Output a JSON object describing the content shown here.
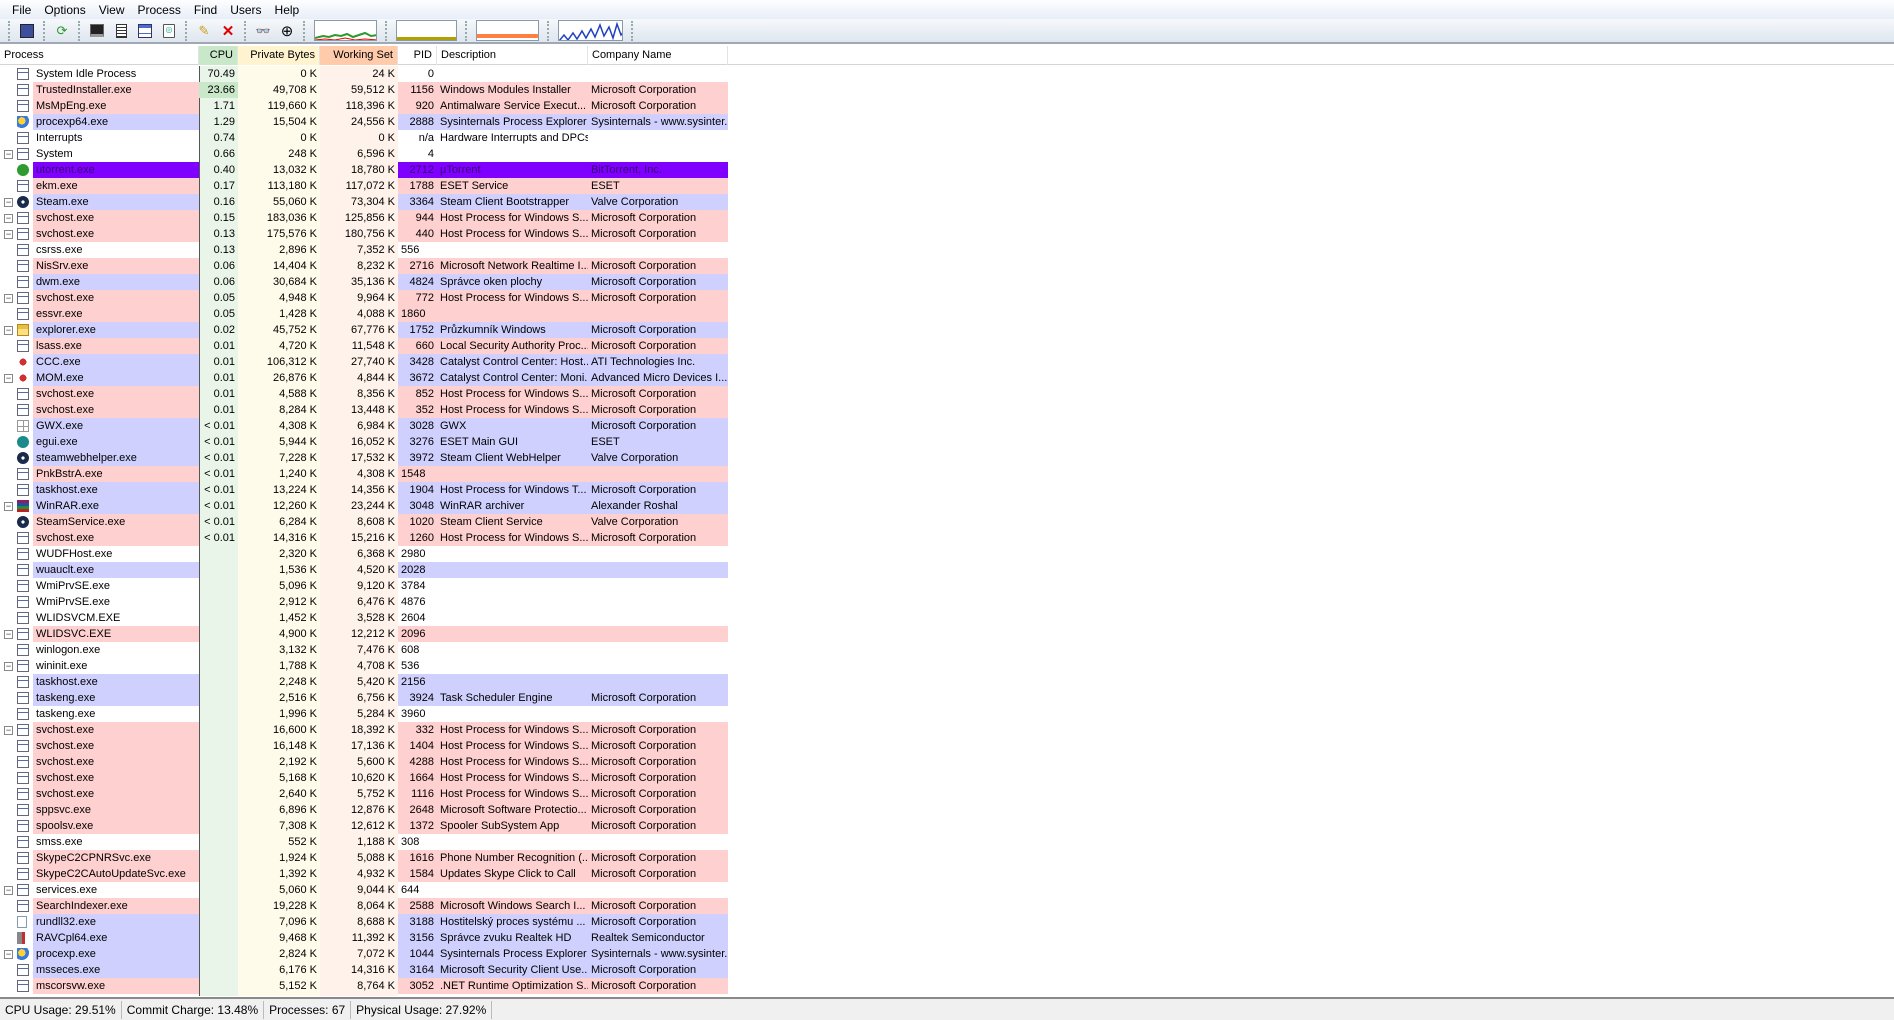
{
  "menu": [
    "File",
    "Options",
    "View",
    "Process",
    "Find",
    "Users",
    "Help"
  ],
  "columns": {
    "process": "Process",
    "cpu": "CPU",
    "private_bytes": "Private Bytes",
    "working_set": "Working Set",
    "pid": "PID",
    "description": "Description",
    "company": "Company Name"
  },
  "colors": {
    "pink": "#ffd0d0",
    "blue": "#d0d0ff",
    "purple": "#8000ff",
    "white": "#ffffff",
    "cpu_col": "#eaf5ea",
    "pb_col": "#fffbea",
    "ws_col": "#fff2ea"
  },
  "status": {
    "cpu": "CPU Usage: 29.51%",
    "commit": "Commit Charge: 13.48%",
    "processes": "Processes: 67",
    "physical": "Physical Usage: 27.92%"
  },
  "rows": [
    [
      "System Idle Process",
      "70.49",
      "0 K",
      "24 K",
      "0",
      "",
      "",
      "white",
      0,
      "win"
    ],
    [
      "TrustedInstaller.exe",
      "23.66",
      "49,708 K",
      "59,512 K",
      "1156",
      "Windows Modules Installer",
      "Microsoft Corporation",
      "pink",
      0,
      "win"
    ],
    [
      "MsMpEng.exe",
      "1.71",
      "119,660 K",
      "118,396 K",
      "920",
      "Antimalware Service Execut...",
      "Microsoft Corporation",
      "pink",
      0,
      "win"
    ],
    [
      "procexp64.exe",
      "1.29",
      "15,504 K",
      "24,556 K",
      "2888",
      "Sysinternals Process Explorer",
      "Sysinternals - www.sysinter...",
      "blue",
      0,
      "procexp"
    ],
    [
      "Interrupts",
      "0.74",
      "0 K",
      "0 K",
      "n/a",
      "Hardware Interrupts and DPCs",
      "",
      "white",
      0,
      "win"
    ],
    [
      "System",
      "0.66",
      "248 K",
      "6,596 K",
      "4",
      "",
      "",
      "white",
      1,
      "win"
    ],
    [
      "utorrent.exe",
      "0.40",
      "13,032 K",
      "18,780 K",
      "2712",
      "µTorrent",
      "BitTorrent, Inc.",
      "purple",
      0,
      "utorrent"
    ],
    [
      "ekm.exe",
      "0.17",
      "113,180 K",
      "117,072 K",
      "1788",
      "ESET Service",
      "ESET",
      "pink",
      0,
      "win"
    ],
    [
      "Steam.exe",
      "0.16",
      "55,060 K",
      "73,304 K",
      "3364",
      "Steam Client Bootstrapper",
      "Valve Corporation",
      "blue",
      1,
      "steam"
    ],
    [
      "svchost.exe",
      "0.15",
      "183,036 K",
      "125,856 K",
      "944",
      "Host Process for Windows S...",
      "Microsoft Corporation",
      "pink",
      1,
      "win"
    ],
    [
      "svchost.exe",
      "0.13",
      "175,576 K",
      "180,756 K",
      "440",
      "Host Process for Windows S...",
      "Microsoft Corporation",
      "pink",
      1,
      "win"
    ],
    [
      "csrss.exe",
      "0.13",
      "2,896 K",
      "7,352 K",
      "556",
      "",
      "",
      "white",
      0,
      "win"
    ],
    [
      "NisSrv.exe",
      "0.06",
      "14,404 K",
      "8,232 K",
      "2716",
      "Microsoft Network Realtime I...",
      "Microsoft Corporation",
      "pink",
      0,
      "win"
    ],
    [
      "dwm.exe",
      "0.06",
      "30,684 K",
      "35,136 K",
      "4824",
      "Správce oken plochy",
      "Microsoft Corporation",
      "blue",
      0,
      "win"
    ],
    [
      "svchost.exe",
      "0.05",
      "4,948 K",
      "9,964 K",
      "772",
      "Host Process for Windows S...",
      "Microsoft Corporation",
      "pink",
      1,
      "win"
    ],
    [
      "essvr.exe",
      "0.05",
      "1,428 K",
      "4,088 K",
      "1860",
      "",
      "",
      "pink",
      0,
      "win"
    ],
    [
      "explorer.exe",
      "0.02",
      "45,752 K",
      "67,776 K",
      "1752",
      "Průzkumník Windows",
      "Microsoft Corporation",
      "blue",
      1,
      "folder"
    ],
    [
      "lsass.exe",
      "0.01",
      "4,720 K",
      "11,548 K",
      "660",
      "Local Security Authority Proc...",
      "Microsoft Corporation",
      "pink",
      0,
      "win"
    ],
    [
      "CCC.exe",
      "0.01",
      "106,312 K",
      "27,740 K",
      "3428",
      "Catalyst Control Center: Host...",
      "ATI Technologies Inc.",
      "blue",
      0,
      "ati"
    ],
    [
      "MOM.exe",
      "0.01",
      "26,876 K",
      "4,844 K",
      "3672",
      "Catalyst Control Center: Moni...",
      "Advanced Micro Devices I...",
      "blue",
      1,
      "ati"
    ],
    [
      "svchost.exe",
      "0.01",
      "4,588 K",
      "8,356 K",
      "852",
      "Host Process for Windows S...",
      "Microsoft Corporation",
      "pink",
      0,
      "win"
    ],
    [
      "svchost.exe",
      "0.01",
      "8,284 K",
      "13,448 K",
      "352",
      "Host Process for Windows S...",
      "Microsoft Corporation",
      "pink",
      0,
      "win"
    ],
    [
      "GWX.exe",
      "< 0.01",
      "4,308 K",
      "6,984 K",
      "3028",
      "GWX",
      "Microsoft Corporation",
      "blue",
      0,
      "gwx"
    ],
    [
      "egui.exe",
      "< 0.01",
      "5,944 K",
      "16,052 K",
      "3276",
      "ESET Main GUI",
      "ESET",
      "blue",
      0,
      "eset"
    ],
    [
      "steamwebhelper.exe",
      "< 0.01",
      "7,228 K",
      "17,532 K",
      "3972",
      "Steam Client WebHelper",
      "Valve Corporation",
      "blue",
      0,
      "steam"
    ],
    [
      "PnkBstrA.exe",
      "< 0.01",
      "1,240 K",
      "4,308 K",
      "1548",
      "",
      "",
      "pink",
      0,
      "win"
    ],
    [
      "taskhost.exe",
      "< 0.01",
      "13,224 K",
      "14,356 K",
      "1904",
      "Host Process for Windows T...",
      "Microsoft Corporation",
      "blue",
      0,
      "win"
    ],
    [
      "WinRAR.exe",
      "< 0.01",
      "12,260 K",
      "23,244 K",
      "3048",
      "WinRAR archiver",
      "Alexander Roshal",
      "blue",
      1,
      "winrar"
    ],
    [
      "SteamService.exe",
      "< 0.01",
      "6,284 K",
      "8,608 K",
      "1020",
      "Steam Client Service",
      "Valve Corporation",
      "pink",
      0,
      "steam"
    ],
    [
      "svchost.exe",
      "< 0.01",
      "14,316 K",
      "15,216 K",
      "1260",
      "Host Process for Windows S...",
      "Microsoft Corporation",
      "pink",
      0,
      "win"
    ],
    [
      "WUDFHost.exe",
      "",
      "2,320 K",
      "6,368 K",
      "2980",
      "",
      "",
      "white",
      0,
      "win"
    ],
    [
      "wuauclt.exe",
      "",
      "1,536 K",
      "4,520 K",
      "2028",
      "",
      "",
      "blue",
      0,
      "win"
    ],
    [
      "WmiPrvSE.exe",
      "",
      "5,096 K",
      "9,120 K",
      "3784",
      "",
      "",
      "white",
      0,
      "win"
    ],
    [
      "WmiPrvSE.exe",
      "",
      "2,912 K",
      "6,476 K",
      "4876",
      "",
      "",
      "white",
      0,
      "win"
    ],
    [
      "WLIDSVCM.EXE",
      "",
      "1,452 K",
      "3,528 K",
      "2604",
      "",
      "",
      "white",
      0,
      "win"
    ],
    [
      "WLIDSVC.EXE",
      "",
      "4,900 K",
      "12,212 K",
      "2096",
      "",
      "",
      "pink",
      1,
      "win"
    ],
    [
      "winlogon.exe",
      "",
      "3,132 K",
      "7,476 K",
      "608",
      "",
      "",
      "white",
      0,
      "win"
    ],
    [
      "wininit.exe",
      "",
      "1,788 K",
      "4,708 K",
      "536",
      "",
      "",
      "white",
      1,
      "win"
    ],
    [
      "taskhost.exe",
      "",
      "2,248 K",
      "5,420 K",
      "2156",
      "",
      "",
      "blue",
      0,
      "win"
    ],
    [
      "taskeng.exe",
      "",
      "2,516 K",
      "6,756 K",
      "3924",
      "Task Scheduler Engine",
      "Microsoft Corporation",
      "blue",
      0,
      "win"
    ],
    [
      "taskeng.exe",
      "",
      "1,996 K",
      "5,284 K",
      "3960",
      "",
      "",
      "white",
      0,
      "win"
    ],
    [
      "svchost.exe",
      "",
      "16,600 K",
      "18,392 K",
      "332",
      "Host Process for Windows S...",
      "Microsoft Corporation",
      "pink",
      1,
      "win"
    ],
    [
      "svchost.exe",
      "",
      "16,148 K",
      "17,136 K",
      "1404",
      "Host Process for Windows S...",
      "Microsoft Corporation",
      "pink",
      0,
      "win"
    ],
    [
      "svchost.exe",
      "",
      "2,192 K",
      "5,600 K",
      "4288",
      "Host Process for Windows S...",
      "Microsoft Corporation",
      "pink",
      0,
      "win"
    ],
    [
      "svchost.exe",
      "",
      "5,168 K",
      "10,620 K",
      "1664",
      "Host Process for Windows S...",
      "Microsoft Corporation",
      "pink",
      0,
      "win"
    ],
    [
      "svchost.exe",
      "",
      "2,640 K",
      "5,752 K",
      "1116",
      "Host Process for Windows S...",
      "Microsoft Corporation",
      "pink",
      0,
      "win"
    ],
    [
      "sppsvc.exe",
      "",
      "6,896 K",
      "12,876 K",
      "2648",
      "Microsoft Software Protectio...",
      "Microsoft Corporation",
      "pink",
      0,
      "win"
    ],
    [
      "spoolsv.exe",
      "",
      "7,308 K",
      "12,612 K",
      "1372",
      "Spooler SubSystem App",
      "Microsoft Corporation",
      "pink",
      0,
      "win"
    ],
    [
      "smss.exe",
      "",
      "552 K",
      "1,188 K",
      "308",
      "",
      "",
      "white",
      0,
      "win"
    ],
    [
      "SkypeC2CPNRSvc.exe",
      "",
      "1,924 K",
      "5,088 K",
      "1616",
      "Phone Number Recognition (...",
      "Microsoft Corporation",
      "pink",
      0,
      "win"
    ],
    [
      "SkypeC2CAutoUpdateSvc.exe",
      "",
      "1,392 K",
      "4,932 K",
      "1584",
      "Updates Skype Click to Call",
      "Microsoft Corporation",
      "pink",
      0,
      "win"
    ],
    [
      "services.exe",
      "",
      "5,060 K",
      "9,044 K",
      "644",
      "",
      "",
      "white",
      1,
      "win"
    ],
    [
      "SearchIndexer.exe",
      "",
      "19,228 K",
      "8,064 K",
      "2588",
      "Microsoft Windows Search I...",
      "Microsoft Corporation",
      "pink",
      0,
      "win"
    ],
    [
      "rundll32.exe",
      "",
      "7,096 K",
      "8,688 K",
      "3188",
      "Hostitelský proces systému ...",
      "Microsoft Corporation",
      "blue",
      0,
      "doc"
    ],
    [
      "RAVCpl64.exe",
      "",
      "9,468 K",
      "11,392 K",
      "3156",
      "Správce zvuku Realtek HD",
      "Realtek Semiconductor",
      "blue",
      0,
      "speaker"
    ],
    [
      "procexp.exe",
      "",
      "2,824 K",
      "7,072 K",
      "1044",
      "Sysinternals Process Explorer",
      "Sysinternals - www.sysinter...",
      "blue",
      1,
      "procexp"
    ],
    [
      "msseces.exe",
      "",
      "6,176 K",
      "14,316 K",
      "3164",
      "Microsoft Security Client Use...",
      "Microsoft Corporation",
      "blue",
      0,
      "win"
    ],
    [
      "mscorsvw.exe",
      "",
      "5,152 K",
      "8,764 K",
      "3052",
      ".NET Runtime Optimization S...",
      "Microsoft Corporation",
      "pink",
      0,
      "win"
    ]
  ]
}
